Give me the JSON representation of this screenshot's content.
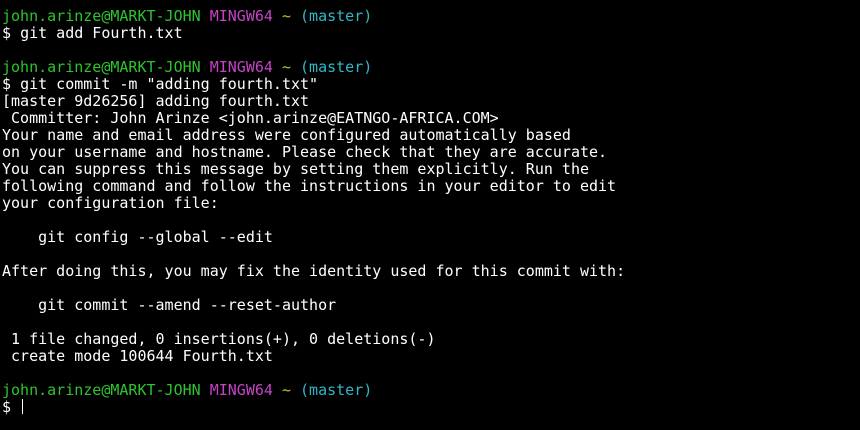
{
  "terminal": {
    "colors": {
      "background": "#000000",
      "text": "#ffffff",
      "user_host": "#2ec42e",
      "system": "#c544c5",
      "path": "#c8c51a",
      "branch": "#2eb8c8"
    },
    "prompt": {
      "user_host": "john.arinze@MARKT-JOHN",
      "system": "MINGW64",
      "path": "~",
      "branch": "(master)",
      "symbol": "$"
    },
    "commands": {
      "first": "git add Fourth.txt",
      "second": "git commit -m \"adding fourth.txt\""
    },
    "output": [
      "[master 9d26256] adding fourth.txt",
      " Committer: John Arinze <john.arinze@EATNGO-AFRICA.COM>",
      "Your name and email address were configured automatically based",
      "on your username and hostname. Please check that they are accurate.",
      "You can suppress this message by setting them explicitly. Run the",
      "following command and follow the instructions in your editor to edit",
      "your configuration file:",
      "",
      "    git config --global --edit",
      "",
      "After doing this, you may fix the identity used for this commit with:",
      "",
      "    git commit --amend --reset-author",
      "",
      " 1 file changed, 0 insertions(+), 0 deletions(-)",
      " create mode 100644 Fourth.txt"
    ]
  }
}
